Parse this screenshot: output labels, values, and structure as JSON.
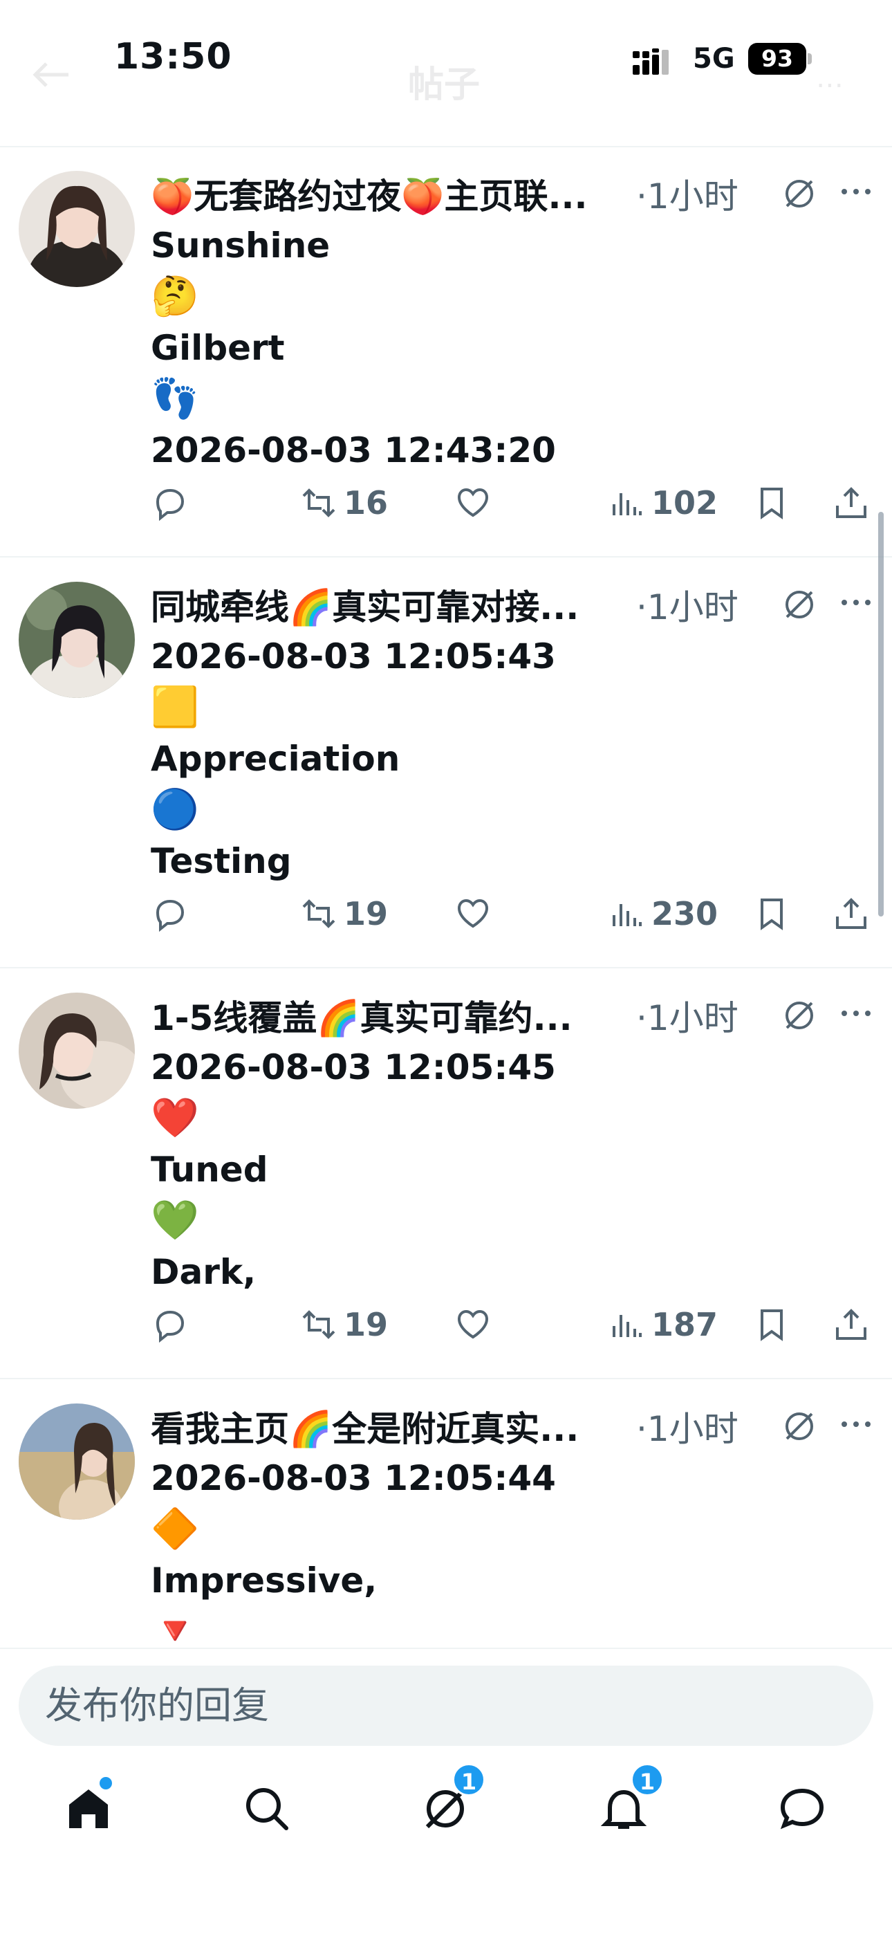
{
  "status_bar": {
    "time": "13:50",
    "network": "5G",
    "battery": "93"
  },
  "header": {
    "title": "帖子"
  },
  "posts": [
    {
      "username": "🍑无套路约过夜🍑主页联...",
      "time": "·1小时",
      "lines": [
        "Sunshine",
        "🤔",
        "Gilbert",
        "👣",
        "2026-08-03 12:43:20"
      ],
      "stats": {
        "reposts": "16",
        "likes": "",
        "views": "102"
      },
      "avatar_colors": [
        "#e8e2dc",
        "#2a2522"
      ]
    },
    {
      "username": "同城牵线🌈真实可靠对接...",
      "time": "·1小时",
      "lines": [
        "2026-08-03 12:05:43",
        "🟨",
        "Appreciation",
        "🔵",
        "Testing"
      ],
      "stats": {
        "reposts": "19",
        "likes": "",
        "views": "230"
      },
      "avatar_colors": [
        "#5e6e58",
        "#1b1a1f"
      ]
    },
    {
      "username": "1-5线覆盖🌈真实可靠约...",
      "time": "·1小时",
      "lines": [
        "2026-08-03 12:05:45",
        "❤️",
        "Tuned",
        "💚",
        "Dark,"
      ],
      "stats": {
        "reposts": "19",
        "likes": "",
        "views": "187"
      },
      "avatar_colors": [
        "#cfc4b6",
        "#3a2c26"
      ]
    },
    {
      "username": "看我主页🌈全是附近真实...",
      "time": "·1小时",
      "lines": [
        "2026-08-03 12:05:44",
        "🔶",
        "Impressive,",
        "🔻",
        ""
      ],
      "stats": {
        "reposts": "",
        "likes": "",
        "views": ""
      },
      "avatar_colors": [
        "#c9b48c",
        "#4a3a30"
      ]
    }
  ],
  "reply": {
    "placeholder": "发布你的回复"
  },
  "tabs": {
    "grok_badge": "1",
    "notifications_badge": "1"
  },
  "colors": {
    "accent": "#1d9bf0",
    "muted": "#536471",
    "divider": "#eff3f4"
  }
}
